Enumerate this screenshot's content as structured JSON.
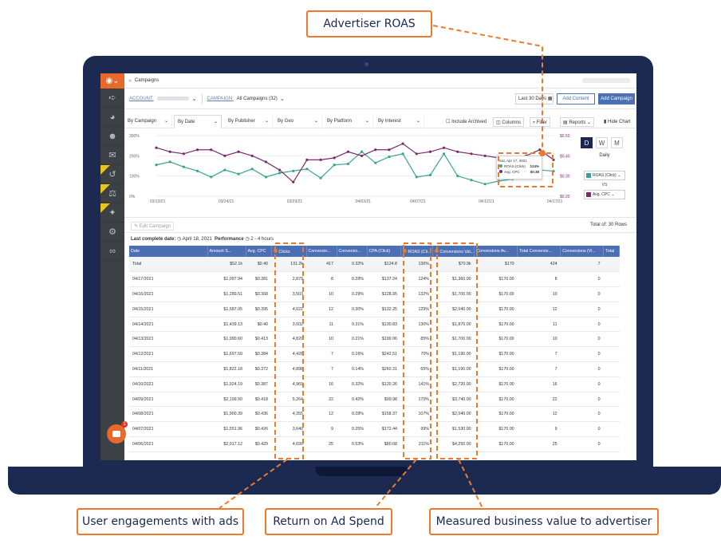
{
  "callouts": {
    "roas": "Advertiser ROAS",
    "engagement": "User engagements with ads",
    "return": "Return on Ad Spend",
    "business_value": "Measured business value to advertiser"
  },
  "topbar": {
    "breadcrumb": "Campaigns"
  },
  "account_bar": {
    "account_label": "ACCOUNT:",
    "campaign_label": "CAMPAIGN:",
    "campaign_value": "All Campaigns (32)",
    "date_range": "Last 30 Days",
    "add_content": "Add Content",
    "add_campaign": "Add Campaign"
  },
  "filters": {
    "tabs": [
      "By Campaign",
      "By Date",
      "By Publisher",
      "By Geo",
      "By Platform",
      "By Interest"
    ],
    "include_archived": "Include Archived",
    "columns": "Columns",
    "filter": "Filter",
    "reports": "Reports",
    "hide_chart": "Hide Chart"
  },
  "chart_panel": {
    "period_buttons": [
      "D",
      "W",
      "M"
    ],
    "period_label": "Daily",
    "metric_a": "ROAS (Click)",
    "vs": "VS",
    "metric_b": "Avg. CPC"
  },
  "tooltip": {
    "date": "Sat, Apr 17, 2021",
    "row1_label": "ROAS (Click)",
    "row1_value": "124%",
    "row2_label": "Avg. CPC",
    "row2_value": "$0.38"
  },
  "colors": {
    "roas": "#3aa38f",
    "cpc": "#7b2a6e",
    "accent": "#ec7a2c",
    "header": "#4a6fb5"
  },
  "chart_data": {
    "type": "line",
    "x": [
      "03/19/21",
      "03/20/21",
      "03/21/21",
      "03/22/21",
      "03/23/21",
      "03/24/21",
      "03/25/21",
      "03/26/21",
      "03/27/21",
      "03/28/21",
      "03/29/21",
      "03/30/21",
      "03/31/21",
      "04/01/21",
      "04/02/21",
      "04/03/21",
      "04/04/21",
      "04/05/21",
      "04/06/21",
      "04/07/21",
      "04/08/21",
      "04/09/21",
      "04/10/21",
      "04/11/21",
      "04/12/21",
      "04/13/21",
      "04/14/21",
      "04/15/21",
      "04/16/21",
      "04/17/21"
    ],
    "x_tick_labels": [
      "03/19/21",
      "03/24/21",
      "03/29/21",
      "04/03/21",
      "04/07/21",
      "04/12/21",
      "04/17/21"
    ],
    "y_left_ticks": [
      "300%",
      "200%",
      "100%",
      "0%"
    ],
    "y_right_ticks": [
      "$0.50",
      "$0.40",
      "$0.30",
      "$0.20"
    ],
    "ylim_left": [
      0,
      300
    ],
    "ylim_right": [
      0.2,
      0.5
    ],
    "series": [
      {
        "name": "ROAS (Click)",
        "axis": "left",
        "values": [
          155,
          170,
          145,
          125,
          95,
          130,
          110,
          135,
          95,
          115,
          125,
          135,
          90,
          155,
          160,
          220,
          165,
          195,
          210,
          95,
          105,
          210,
          100,
          80,
          60,
          75,
          85,
          100,
          130,
          124
        ]
      },
      {
        "name": "Avg. CPC",
        "axis": "right",
        "values": [
          0.44,
          0.42,
          0.41,
          0.43,
          0.43,
          0.4,
          0.42,
          0.4,
          0.37,
          0.33,
          0.27,
          0.38,
          0.38,
          0.39,
          0.42,
          0.4,
          0.43,
          0.43,
          0.46,
          0.41,
          0.42,
          0.44,
          0.42,
          0.41,
          0.4,
          0.39,
          0.38,
          0.4,
          0.43,
          0.38
        ]
      }
    ]
  },
  "table_bar": {
    "edit_campaign": "Edit Campaign",
    "total_rows": "Total of: 30 Rows"
  },
  "last_complete": {
    "label": "Last complete date:",
    "date": "April 18, 2021",
    "perf_label": "Performance",
    "perf_value": "2 - 4 hours"
  },
  "table": {
    "columns": [
      "Date",
      "Amount S...",
      "Avg. CPC",
      "Clicks",
      "Conversio...",
      "Conversio...",
      "CPA (Click)",
      "ROAS (Cli...",
      "Conversions Val...",
      "Conversions Av...",
      "Total Conversio...",
      "Conversions (Vi...",
      "Total"
    ],
    "rows": [
      [
        "Total",
        "$52.1k",
        "$0.40",
        "131.2k",
        "417",
        "0.32%",
        "$124.8",
        "136%",
        "$70.9k",
        "$170",
        "424",
        "7",
        ""
      ],
      [
        "04/17/2021",
        "$1,097.94",
        "$0.381",
        "2,879",
        "8",
        "0.28%",
        "$137.24",
        "124%",
        "$1,360.00",
        "$170.00",
        "8",
        "0",
        ""
      ],
      [
        "04/16/2021",
        "$1,289.51",
        "$0.368",
        "3,503",
        "10",
        "0.29%",
        "$128.95",
        "132%",
        "$1,700.00",
        "$170.00",
        "10",
        "0",
        ""
      ],
      [
        "04/15/2021",
        "$1,587.05",
        "$0.395",
        "4,022",
        "12",
        "0.30%",
        "$132.25",
        "129%",
        "$2,040.00",
        "$170.00",
        "12",
        "0",
        ""
      ],
      [
        "04/14/2021",
        "$1,439.13",
        "$0.40",
        "3,602",
        "11",
        "0.31%",
        "$130.83",
        "130%",
        "$1,870.00",
        "$170.00",
        "11",
        "0",
        ""
      ],
      [
        "04/13/2021",
        "$1,990.60",
        "$0.413",
        "4,820",
        "10",
        "0.21%",
        "$199.06",
        "85%",
        "$1,700.00",
        "$170.00",
        "10",
        "0",
        ""
      ],
      [
        "04/12/2021",
        "$1,697.59",
        "$0.384",
        "4,428",
        "7",
        "0.16%",
        "$242.51",
        "70%",
        "$1,190.00",
        "$170.00",
        "7",
        "0",
        ""
      ],
      [
        "04/11/2021",
        "$1,822.18",
        "$0.372",
        "4,898",
        "7",
        "0.14%",
        "$260.31",
        "65%",
        "$1,190.00",
        "$170.00",
        "7",
        "0",
        ""
      ],
      [
        "04/10/2021",
        "$1,924.19",
        "$0.387",
        "4,969",
        "16",
        "0.32%",
        "$120.26",
        "141%",
        "$2,720.00",
        "$170.00",
        "16",
        "0",
        ""
      ],
      [
        "04/09/2021",
        "$2,199.50",
        "$0.418",
        "5,264",
        "22",
        "0.42%",
        "$99.98",
        "170%",
        "$3,740.00",
        "$170.00",
        "22",
        "0",
        ""
      ],
      [
        "04/08/2021",
        "$1,900.39",
        "$0.436",
        "4,355",
        "12",
        "0.28%",
        "$158.37",
        "107%",
        "$2,040.00",
        "$170.00",
        "12",
        "0",
        ""
      ],
      [
        "04/07/2021",
        "$1,551.96",
        "$0.426",
        "3,640",
        "9",
        "0.25%",
        "$172.44",
        "99%",
        "$1,530.00",
        "$170.00",
        "9",
        "0",
        ""
      ],
      [
        "04/06/2021",
        "$2,017.12",
        "$0.429",
        "4,699",
        "25",
        "0.53%",
        "$80.68",
        "211%",
        "$4,250.00",
        "$170.00",
        "25",
        "0",
        ""
      ]
    ]
  }
}
